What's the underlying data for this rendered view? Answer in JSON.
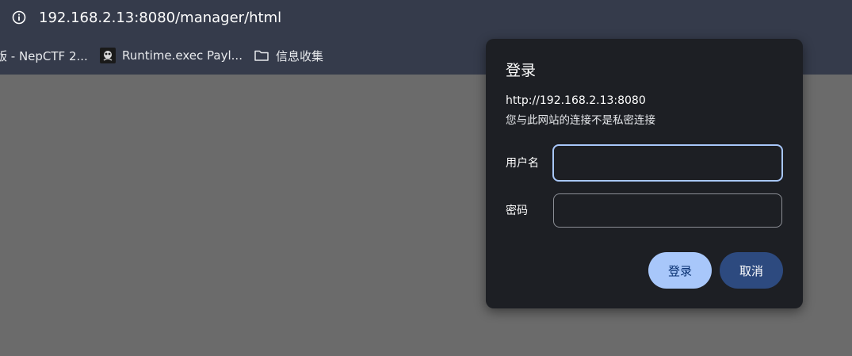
{
  "address_bar": {
    "url": "192.168.2.13:8080/manager/html",
    "icon": "info-icon"
  },
  "bookmarks": [
    {
      "label": "版 - NepCTF 2...",
      "icon": "page-icon"
    },
    {
      "label": "Runtime.exec Payl...",
      "icon": "favicon-image"
    },
    {
      "label": "信息收集",
      "icon": "folder-icon"
    }
  ],
  "auth_dialog": {
    "title": "登录",
    "origin": "http://192.168.2.13:8080",
    "warning": "您与此网站的连接不是私密连接",
    "username_label": "用户名",
    "username_value": "",
    "password_label": "密码",
    "password_value": "",
    "login_label": "登录",
    "cancel_label": "取消"
  },
  "colors": {
    "toolbar_bg": "#353b4b",
    "page_overlay": "#6b6b6b",
    "dialog_bg": "#1d1f24",
    "primary_button": "#a8c7fa",
    "secondary_button": "#2d4a7f",
    "focus_ring": "#a8c7fa"
  }
}
